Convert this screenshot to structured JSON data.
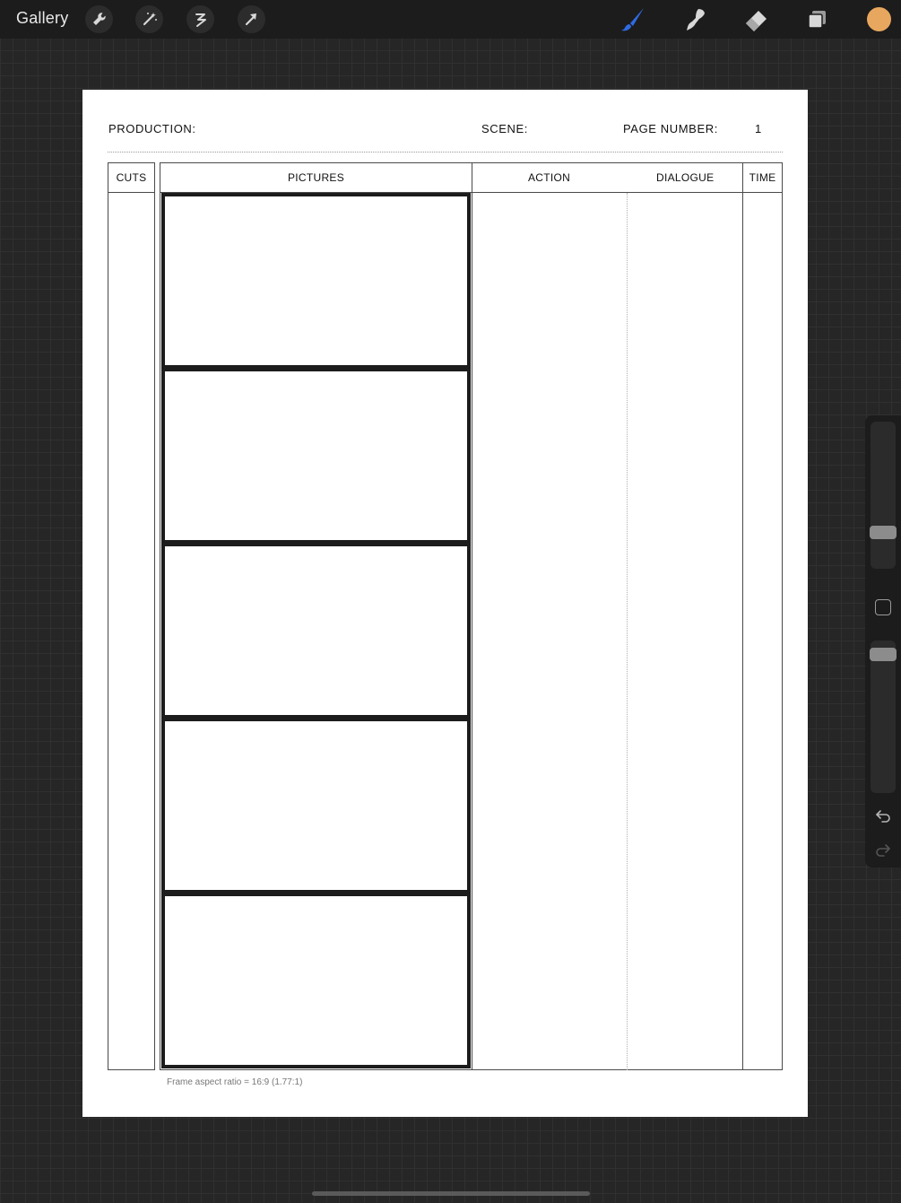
{
  "toolbar": {
    "gallery_label": "Gallery",
    "left_tools": [
      {
        "name": "actions",
        "icon": "wrench-icon"
      },
      {
        "name": "adjustments",
        "icon": "magic-wand-icon"
      },
      {
        "name": "selection",
        "icon": "selection-icon"
      },
      {
        "name": "transform",
        "icon": "transform-arrow-icon"
      }
    ],
    "right_tools": [
      {
        "name": "brush",
        "icon": "brush-icon",
        "active": true
      },
      {
        "name": "smudge",
        "icon": "smudge-icon"
      },
      {
        "name": "eraser",
        "icon": "eraser-icon"
      },
      {
        "name": "layers",
        "icon": "layers-icon"
      }
    ],
    "active_color": "#E8A75E",
    "accent_color": "#2F6BE5"
  },
  "sidebar": {
    "brush_size": 0.22,
    "brush_opacity": 0.95
  },
  "document": {
    "production_label": "PRODUCTION:",
    "scene_label": "SCENE:",
    "page_number_label": "PAGE NUMBER:",
    "page_number_value": "1",
    "columns": {
      "cuts": "CUTS",
      "pictures": "PICTURES",
      "action": "ACTION",
      "dialogue": "DIALOGUE",
      "time": "TIME"
    },
    "frame_count": 5,
    "footnote": "Frame aspect ratio = 16:9 (1.77:1)"
  }
}
